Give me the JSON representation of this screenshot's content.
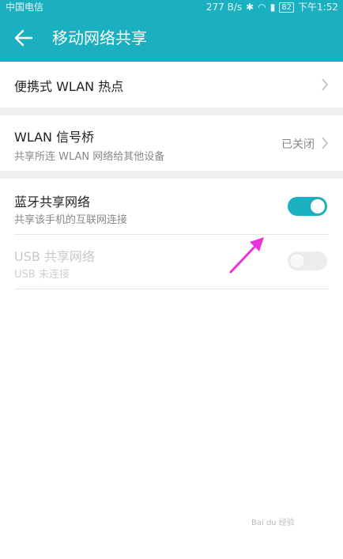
{
  "statusbar": {
    "carrier": "中国电信",
    "speed": "277 B/s",
    "battery": "82",
    "time": "下午1:52"
  },
  "appbar": {
    "title": "移动网络共享",
    "back_icon": "arrow-left-icon"
  },
  "items": [
    {
      "title": "便携式 WLAN 热点"
    },
    {
      "title": "WLAN 信号桥",
      "subtitle": "共享所连 WLAN 网络给其他设备",
      "value": "已关闭"
    },
    {
      "title": "蓝牙共享网络",
      "subtitle": "共享该手机的互联网连接",
      "enabled": true
    },
    {
      "title": "USB 共享网络",
      "subtitle": "USB 未连接",
      "enabled": false,
      "disabled": true
    }
  ],
  "colors": {
    "accent": "#1ab0c0",
    "annotation_arrow": "#e833d8"
  }
}
